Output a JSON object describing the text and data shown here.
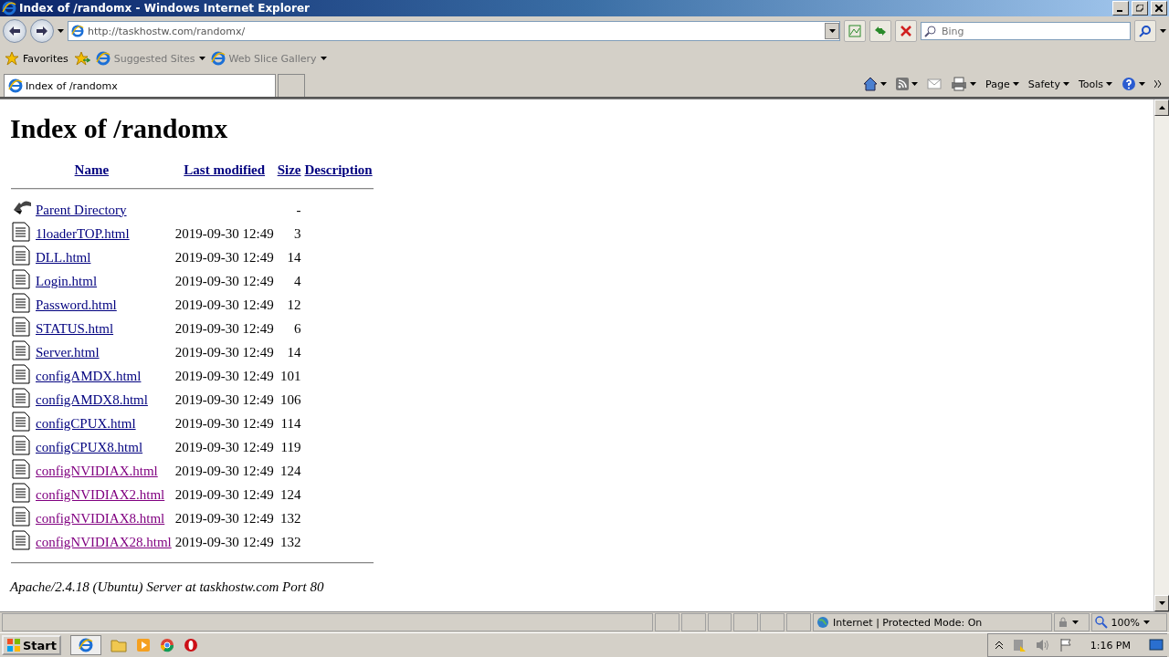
{
  "window": {
    "title": "Index of /randomx - Windows Internet Explorer"
  },
  "address_bar": {
    "url": "http://taskhostw.com/randomx/"
  },
  "search": {
    "placeholder": "Bing"
  },
  "favorites_bar": {
    "favorites": "Favorites",
    "items": [
      "Suggested Sites",
      "Web Slice Gallery"
    ]
  },
  "tabs": [
    {
      "label": "Index of /randomx",
      "selected": true
    }
  ],
  "command_bar": [
    "Page",
    "Safety",
    "Tools"
  ],
  "page": {
    "heading": "Index of /randomx",
    "columns": [
      "Name",
      "Last modified",
      "Size",
      "Description"
    ],
    "rows": [
      {
        "kind": "parent",
        "name": "Parent Directory",
        "modified": "",
        "size": "-",
        "visited": false
      },
      {
        "kind": "file",
        "name": "1loaderTOP.html",
        "modified": "2019-09-30 12:49",
        "size": "3",
        "visited": false
      },
      {
        "kind": "file",
        "name": "DLL.html",
        "modified": "2019-09-30 12:49",
        "size": "14",
        "visited": false
      },
      {
        "kind": "file",
        "name": "Login.html",
        "modified": "2019-09-30 12:49",
        "size": "4",
        "visited": false
      },
      {
        "kind": "file",
        "name": "Password.html",
        "modified": "2019-09-30 12:49",
        "size": "12",
        "visited": false
      },
      {
        "kind": "file",
        "name": "STATUS.html",
        "modified": "2019-09-30 12:49",
        "size": "6",
        "visited": false
      },
      {
        "kind": "file",
        "name": "Server.html",
        "modified": "2019-09-30 12:49",
        "size": "14",
        "visited": false
      },
      {
        "kind": "file",
        "name": "configAMDX.html",
        "modified": "2019-09-30 12:49",
        "size": "101",
        "visited": false
      },
      {
        "kind": "file",
        "name": "configAMDX8.html",
        "modified": "2019-09-30 12:49",
        "size": "106",
        "visited": false
      },
      {
        "kind": "file",
        "name": "configCPUX.html",
        "modified": "2019-09-30 12:49",
        "size": "114",
        "visited": false
      },
      {
        "kind": "file",
        "name": "configCPUX8.html",
        "modified": "2019-09-30 12:49",
        "size": "119",
        "visited": false
      },
      {
        "kind": "file",
        "name": "configNVIDIAX.html",
        "modified": "2019-09-30 12:49",
        "size": "124",
        "visited": true
      },
      {
        "kind": "file",
        "name": "configNVIDIAX2.html",
        "modified": "2019-09-30 12:49",
        "size": "124",
        "visited": true
      },
      {
        "kind": "file",
        "name": "configNVIDIAX8.html",
        "modified": "2019-09-30 12:49",
        "size": "132",
        "visited": true
      },
      {
        "kind": "file",
        "name": "configNVIDIAX28.html",
        "modified": "2019-09-30 12:49",
        "size": "132",
        "visited": true
      }
    ],
    "footer": "Apache/2.4.18 (Ubuntu) Server at taskhostw.com Port 80"
  },
  "status_bar": {
    "zone": "Internet | Protected Mode: On",
    "zoom": "100%"
  },
  "taskbar": {
    "start": "Start",
    "clock": "1:16 PM"
  }
}
